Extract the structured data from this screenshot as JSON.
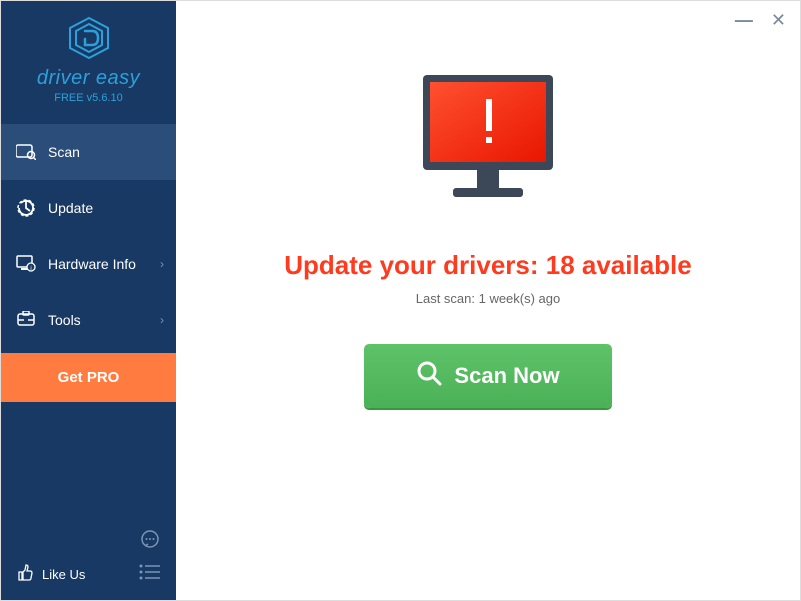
{
  "brand": {
    "name": "driver easy",
    "version": "FREE v5.6.10"
  },
  "sidebar": {
    "scan": "Scan",
    "update": "Update",
    "hardware_info": "Hardware Info",
    "tools": "Tools",
    "get_pro": "Get PRO",
    "like_us": "Like Us"
  },
  "main": {
    "headline": "Update your drivers: 18 available",
    "last_scan": "Last scan: 1 week(s) ago",
    "scan_button": "Scan Now"
  }
}
